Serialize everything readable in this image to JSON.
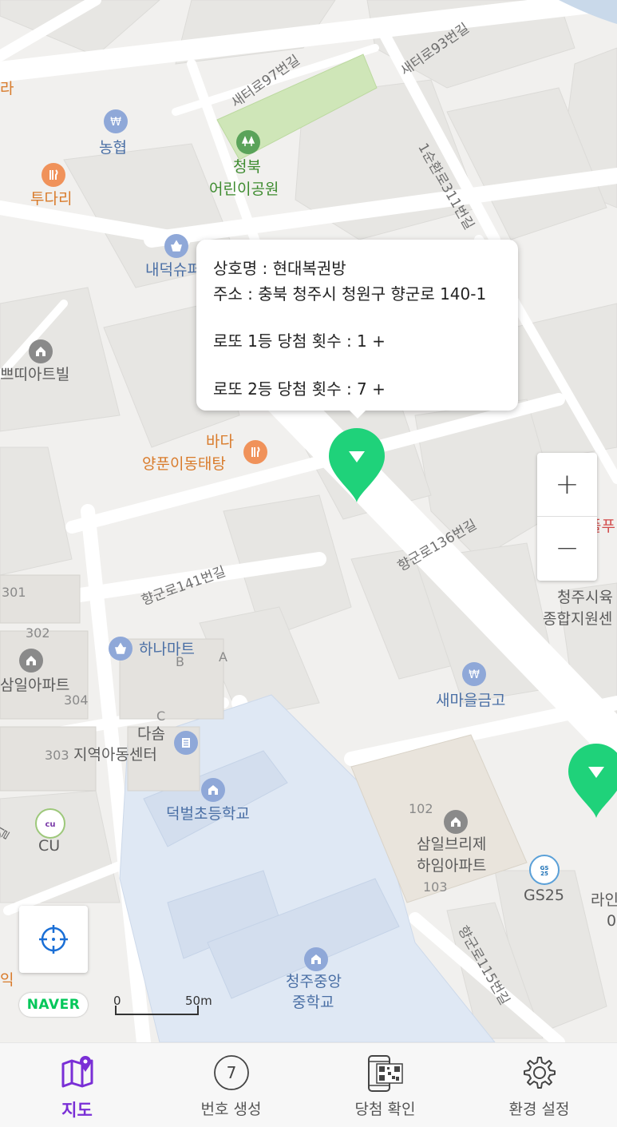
{
  "map": {
    "labels": {
      "ra": "라",
      "nonghyup": "농협",
      "tudari": "투다리",
      "park_line1": "청북",
      "park_line2": "어린이공원",
      "naedeok": "내덕슈퍼",
      "ppeutti": "쁘띠아트빌",
      "bada_line1": "바다",
      "bada_line2": "양푼이동태탕",
      "hanamart": "하나마트",
      "samil_apt": "삼일아파트",
      "dasom_line1": "다솜",
      "dasom_line2": "지역아동센터",
      "deokbeol": "덕벌초등학교",
      "cu": "CU",
      "saemaeul": "새마을금고",
      "samil_bridge_line1": "삼일브리제",
      "samil_bridge_line2": "하임아파트",
      "gs25": "GS25",
      "cheongju_middle_line1": "청주중앙",
      "cheongju_middle_line2": "중학교",
      "cheongju_si_line1": "청주시육",
      "cheongju_si_line2": "종합지원센",
      "rain": "라인",
      "rain_sub": "0",
      "ik": "익",
      "ipu": "플푸",
      "b301": "301",
      "b302": "302",
      "b303": "303",
      "b304": "304",
      "bA": "A",
      "bB": "B",
      "bC": "C",
      "b102": "102",
      "b103": "103",
      "gil": "길"
    },
    "roads": {
      "saeteo97": "새터로97번길",
      "saeteo93": "새터로93번길",
      "sunhwan311": "1순환로311번길",
      "hyanggun136": "향군로136번길",
      "hyanggun141": "향군로141번길",
      "hyanggun115": "향군로115번길"
    }
  },
  "popup": {
    "store_name": "상호명 : 현대복권방",
    "address": "주소 : 충북 청주시 청원구 향군로 140-1",
    "first_prize": "로또 1등 당첨 횟수 :  1 +",
    "second_prize": "로또 2등 당첨 횟수 :  7 +"
  },
  "controls": {
    "zoom_in": "+",
    "zoom_out": "−",
    "naver_logo": "NAVER",
    "scale_zero": "0",
    "scale_distance": "50m"
  },
  "tabs": [
    {
      "label": "지도",
      "icon": "map-pin-icon",
      "active": true
    },
    {
      "label": "번호 생성",
      "icon": "number-ball-icon",
      "active": false,
      "badge": "7"
    },
    {
      "label": "당첨 확인",
      "icon": "qr-phone-icon",
      "active": false
    },
    {
      "label": "환경 설정",
      "icon": "gear-icon",
      "active": false
    }
  ],
  "colors": {
    "accent": "#7a2fd6",
    "marker": "#1fd27a",
    "park": "#cfe6b8",
    "school_area": "#dfe8f4"
  }
}
